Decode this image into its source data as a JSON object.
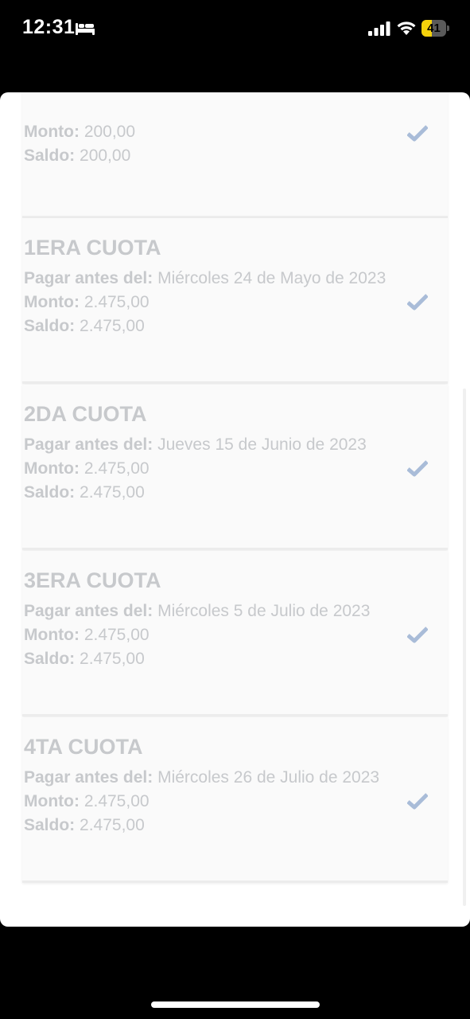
{
  "status_bar": {
    "time": "12:31",
    "battery_level": "41",
    "battery_fraction": 0.41,
    "icons": [
      "bed-icon",
      "cellular-signal-icon",
      "wifi-icon",
      "battery-icon"
    ]
  },
  "colors": {
    "text_faded": "#c7c9cc",
    "check_color": "#a9bcd8",
    "card_bg": "#fafafa",
    "battery_accent": "#f5d20b"
  },
  "installments": {
    "partial": {
      "monto_label": "Monto:",
      "monto_value": "200,00",
      "saldo_label": "Saldo:",
      "saldo_value": "200,00"
    },
    "items": [
      {
        "title": "1ERA CUOTA",
        "pagar_label": "Pagar antes del:",
        "pagar_value": "Miércoles 24 de Mayo de 2023",
        "monto_label": "Monto:",
        "monto_value": "2.475,00",
        "saldo_label": "Saldo:",
        "saldo_value": "2.475,00"
      },
      {
        "title": "2DA CUOTA",
        "pagar_label": "Pagar antes del:",
        "pagar_value": "Jueves 15 de Junio de 2023",
        "monto_label": "Monto:",
        "monto_value": "2.475,00",
        "saldo_label": "Saldo:",
        "saldo_value": "2.475,00"
      },
      {
        "title": "3ERA CUOTA",
        "pagar_label": "Pagar antes del:",
        "pagar_value": "Miércoles 5 de Julio de 2023",
        "monto_label": "Monto:",
        "monto_value": "2.475,00",
        "saldo_label": "Saldo:",
        "saldo_value": "2.475,00"
      },
      {
        "title": "4TA CUOTA",
        "pagar_label": "Pagar antes del:",
        "pagar_value": "Miércoles 26 de Julio de 2023",
        "monto_label": "Monto:",
        "monto_value": "2.475,00",
        "saldo_label": "Saldo:",
        "saldo_value": "2.475,00"
      }
    ]
  }
}
